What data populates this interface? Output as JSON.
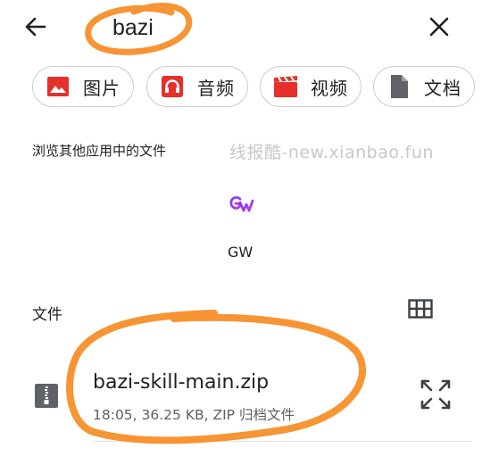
{
  "search": {
    "query": "bazi"
  },
  "chips": [
    {
      "label": "图片",
      "icon": "image-icon",
      "color": "#e5302b"
    },
    {
      "label": "音频",
      "icon": "headphones-icon",
      "color": "#e5302b"
    },
    {
      "label": "视频",
      "icon": "video-icon",
      "color": "#e5302b"
    },
    {
      "label": "文档",
      "icon": "document-icon",
      "color": "#5f6368"
    }
  ],
  "browse_other_apps": "浏览其他应用中的文件",
  "watermark": "线报酷-new.xianbao.fun",
  "apps": [
    {
      "label": "GW",
      "icon": "gw-app-icon"
    }
  ],
  "files_section": {
    "title": "文件"
  },
  "files": [
    {
      "name": "bazi-skill-main.zip",
      "meta": "18:05, 36.25 KB, ZIP 归档文件",
      "icon": "zip-file-icon"
    }
  ],
  "colors": {
    "annotation": "#f79433",
    "accent_red": "#e5302b"
  }
}
